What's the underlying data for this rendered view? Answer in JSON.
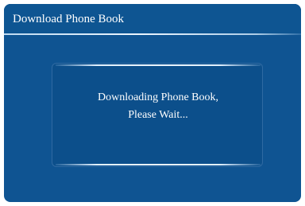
{
  "window": {
    "title": "Download Phone Book"
  },
  "dialog": {
    "line1": "Downloading Phone Book,",
    "line2": "Please Wait..."
  },
  "colors": {
    "background": "#0f5492",
    "text": "#ffffff",
    "rule": "#e6f2ff"
  }
}
